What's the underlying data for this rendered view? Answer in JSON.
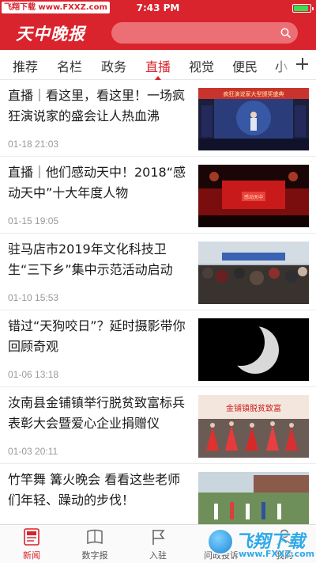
{
  "status_bar": {
    "watermark": "飞翔下载 www.FXXZ.com",
    "time": "7:43 PM"
  },
  "header": {
    "logo": "天中晚报",
    "search_placeholder": ""
  },
  "tabs": [
    {
      "label": "推荐",
      "active": false
    },
    {
      "label": "名栏",
      "active": false
    },
    {
      "label": "政务",
      "active": false
    },
    {
      "label": "直播",
      "active": true
    },
    {
      "label": "视觉",
      "active": false
    },
    {
      "label": "便民",
      "active": false
    },
    {
      "label": "小",
      "active": false
    }
  ],
  "news": [
    {
      "title": "直播｜看这里，看这里！一场疯狂演说家的盛会让人热血沸",
      "date": "01-18 21:03",
      "image": "stage-speaker-photo",
      "image_text": "疯狂演说家大型颁奖盛典"
    },
    {
      "title": "直播｜他们感动天中！2018“感动天中”十大年度人物",
      "date": "01-15 19:05",
      "image": "red-stage-ceremony-photo",
      "image_text": "感动天中"
    },
    {
      "title": "驻马店市2019年文化科技卫生“三下乡”集中示范活动启动",
      "date": "01-10 15:53",
      "image": "outdoor-crowd-event-photo",
      "image_text": ""
    },
    {
      "title": "错过“天狗咬日”？延时摄影带你回顾奇观",
      "date": "01-06 13:18",
      "image": "solar-eclipse-photo",
      "image_text": ""
    },
    {
      "title": "汝南县金铺镇举行脱贫致富标兵表彰大会暨爱心企业捐赠仪",
      "date": "01-03 20:11",
      "image": "red-dance-performance-photo",
      "image_text": "金铺镇脱贫致富"
    },
    {
      "title": "竹竿舞 篝火晚会 看看这些老师们年轻、躁动的步伐！",
      "date": "",
      "image": "campus-dance-photo",
      "image_text": ""
    }
  ],
  "bottom_nav": [
    {
      "label": "新闻",
      "icon": "news-icon",
      "active": true
    },
    {
      "label": "数字报",
      "icon": "newspaper-icon",
      "active": false
    },
    {
      "label": "入驻",
      "icon": "flag-icon",
      "active": false
    },
    {
      "label": "问政投诉",
      "icon": "complaint-icon",
      "active": false
    },
    {
      "label": "我的",
      "icon": "profile-icon",
      "active": false
    }
  ],
  "watermark_badge": {
    "main": "飞翔下载",
    "sub": "www.FXXZ.com"
  },
  "colors": {
    "brand_red": "#d9232d",
    "search_bg": "#eb6f75",
    "date_gray": "#9a9a9a"
  }
}
